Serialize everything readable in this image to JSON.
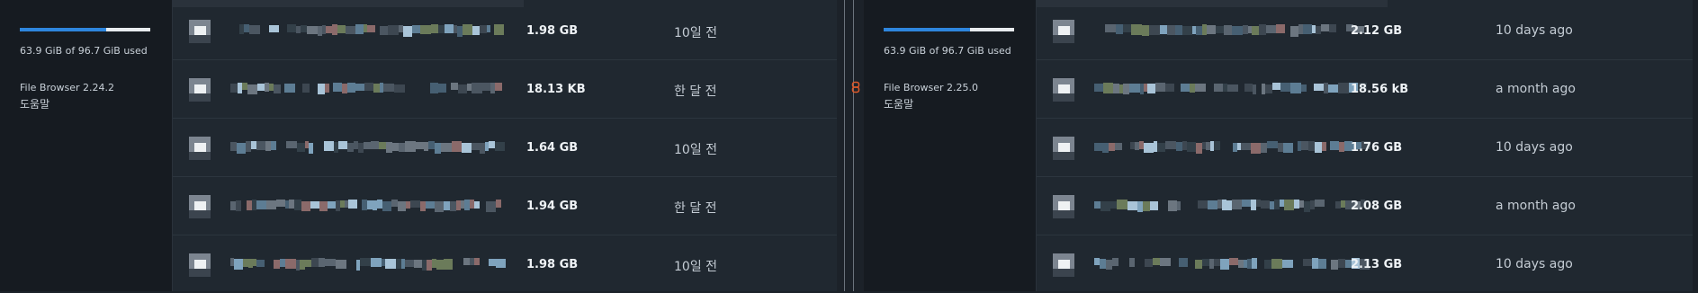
{
  "left": {
    "sidebar": {
      "usage_text": "63.9 GiB of 96.7 GiB used",
      "usage_fraction": 0.661,
      "version": "File Browser 2.24.2",
      "help": "도움말"
    },
    "rows": [
      {
        "size": "1.98 GB",
        "modified": "10일 전"
      },
      {
        "size": "18.13 KB",
        "modified": "한 달 전"
      },
      {
        "size": "1.64 GB",
        "modified": "10일 전"
      },
      {
        "size": "1.94 GB",
        "modified": "한 달 전"
      },
      {
        "size": "1.98 GB",
        "modified": "10일 전"
      }
    ]
  },
  "right": {
    "sidebar": {
      "usage_text": "63.9 GiB of 96.7 GiB used",
      "usage_fraction": 0.661,
      "version": "File Browser 2.25.0",
      "help": "도움말"
    },
    "rows": [
      {
        "size": "2.12 GB",
        "modified": "10 days ago"
      },
      {
        "size": "18.56 kB",
        "modified": "a month ago"
      },
      {
        "size": "1.76 GB",
        "modified": "10 days ago"
      },
      {
        "size": "2.08 GB",
        "modified": "a month ago"
      },
      {
        "size": "2.13 GB",
        "modified": "10 days ago"
      }
    ]
  },
  "colors": {
    "accent": "#2e86de",
    "link": "#e05a2a"
  },
  "icons": {
    "file": "file-icon",
    "link": "link-icon"
  }
}
